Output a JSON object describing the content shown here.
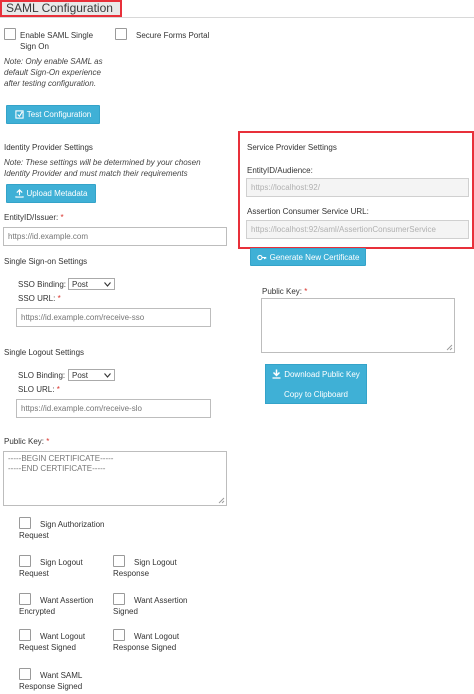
{
  "title": "SAML Configuration",
  "options": {
    "enable_saml_label": "Enable SAML Single Sign On",
    "secure_forms_label": "Secure Forms Portal",
    "note": "Note: Only enable SAML as default Sign-On experience after testing configuration.",
    "test_button": "Test Configuration"
  },
  "idp": {
    "heading": "Identity Provider Settings",
    "note": "Note: These settings will be determined by your chosen Identity Provider and must match their requirements",
    "upload_button": "Upload Metadata",
    "entity_label": "EntityID/Issuer:",
    "entity_placeholder": "https://id.example.com",
    "sso_heading": "Single Sign-on Settings",
    "sso_binding_label": "SSO Binding:",
    "sso_binding_value": "Post",
    "sso_url_label": "SSO URL:",
    "sso_url_placeholder": "https://id.example.com/receive-sso",
    "slo_heading": "Single Logout Settings",
    "slo_binding_label": "SLO Binding:",
    "slo_binding_value": "Post",
    "slo_url_label": "SLO URL:",
    "slo_url_placeholder": "https://id.example.com/receive-slo",
    "public_key_label": "Public Key:",
    "public_key_value": "-----BEGIN CERTIFICATE-----\n-----END CERTIFICATE-----"
  },
  "sp": {
    "heading": "Service Provider Settings",
    "entity_label": "EntityID/Audience:",
    "entity_value": "https://localhost:92/",
    "acs_label": "Assertion Consumer Service URL:",
    "acs_value": "https://localhost:92/saml/AssertionConsumerService",
    "generate_button": "Generate New Certificate",
    "public_key_label": "Public Key:",
    "download_button": "Download Public Key",
    "copy_button": "Copy to Clipboard"
  },
  "checks": {
    "sign_auth_request": "Sign Authorization Request",
    "sign_logout_request": "Sign Logout Request",
    "sign_logout_response": "Sign Logout Response",
    "want_assertion_encrypted": "Want Assertion Encrypted",
    "want_assertion_signed": "Want Assertion Signed",
    "want_logout_request_signed": "Want Logout Request Signed",
    "want_logout_response_signed": "Want Logout Response Signed",
    "want_saml_response_signed": "Want SAML Response Signed"
  },
  "required_mark": "*",
  "colors": {
    "accent": "#3fb0d6",
    "highlight": "#e8303a",
    "required": "#d9312b"
  }
}
